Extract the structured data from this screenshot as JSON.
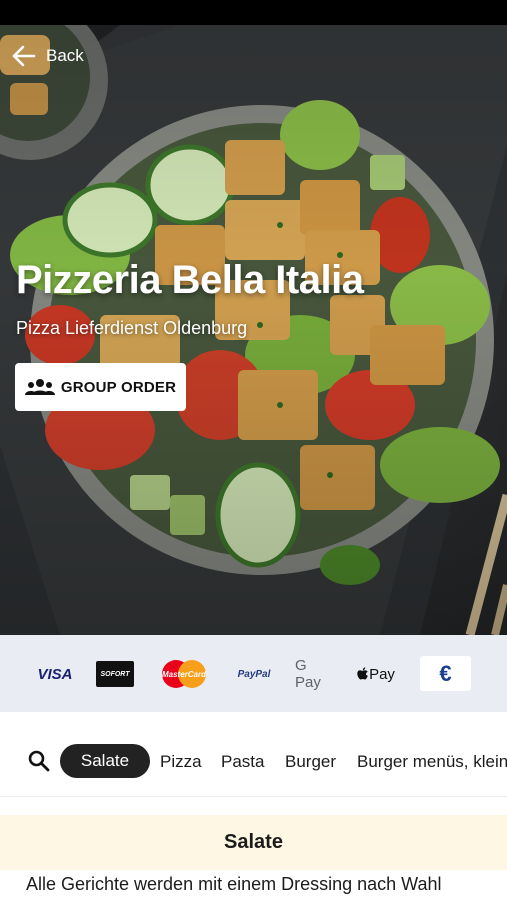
{
  "header": {
    "back_label": "Back",
    "title": "Pizzeria Bella Italia",
    "subtitle": "Pizza Lieferdienst Oldenburg",
    "group_order_label": "GROUP ORDER"
  },
  "payments": {
    "visa": "VISA",
    "sofort": "SOFORT",
    "mastercard": "MasterCard",
    "paypal": "PayPal",
    "gpay": "G Pay",
    "applepay": "Pay",
    "cash": "€"
  },
  "categories": {
    "active": "Salate",
    "items": [
      "Pizza",
      "Pasta",
      "Burger",
      "Burger menüs, klein"
    ]
  },
  "section": {
    "title": "Salate",
    "note": "Alle Gerichte werden mit einem Dressing nach Wahl"
  },
  "colors": {
    "accent_dark": "#222222",
    "payment_bar": "#e9ecf3",
    "section_bg": "#fdf7e4"
  }
}
